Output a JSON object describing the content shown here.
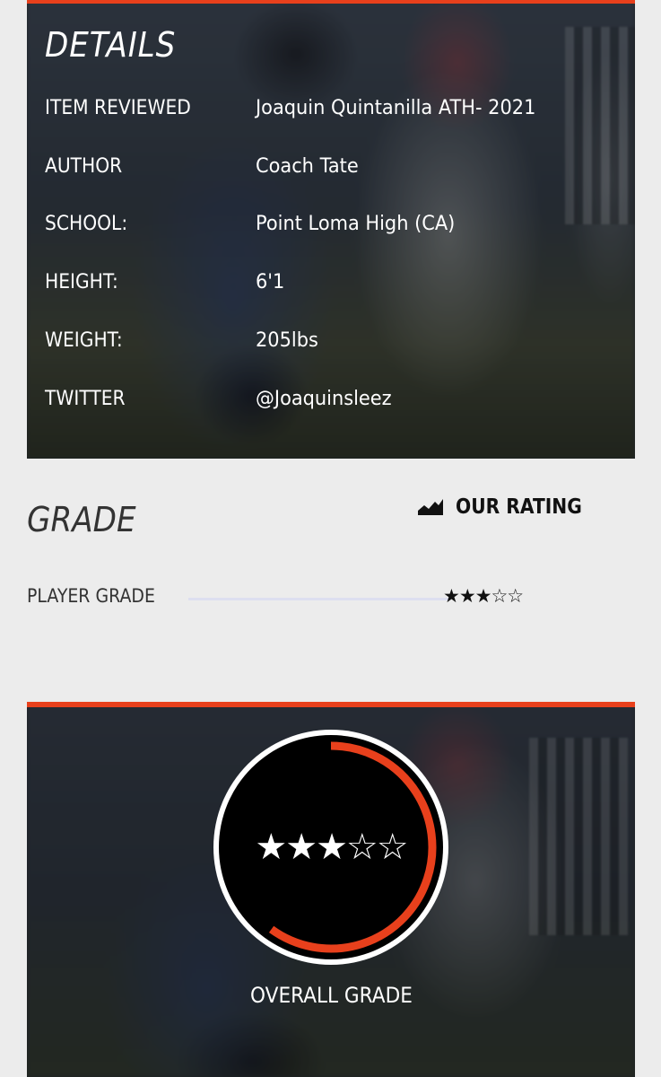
{
  "details": {
    "title": "DETAILS",
    "rows": [
      {
        "label": "ITEM REVIEWED",
        "value": "Joaquin Quintanilla ATH- 2021"
      },
      {
        "label": "AUTHOR",
        "value": "Coach Tate"
      },
      {
        "label": "SCHOOL:",
        "value": "Point Loma High (CA)"
      },
      {
        "label": "HEIGHT:",
        "value": "6'1"
      },
      {
        "label": "WEIGHT:",
        "value": "205lbs"
      },
      {
        "label": "TWITTER",
        "value": "@Joaquinsleez"
      }
    ]
  },
  "grade": {
    "title": "GRADE",
    "our_rating_label": "OUR RATING",
    "our_rating_icon": "chart-area-icon",
    "player_grade_label": "PLAYER GRADE",
    "player_grade_stars": "★★★☆☆",
    "player_grade_value": 3,
    "player_grade_max": 5
  },
  "overall": {
    "label": "OVERALL GRADE",
    "stars": "★★★☆☆",
    "rating": 3,
    "max": 5
  },
  "colors": {
    "accent": "#e8401c",
    "panel": "#2a2f36",
    "page_bg": "#ececec"
  }
}
